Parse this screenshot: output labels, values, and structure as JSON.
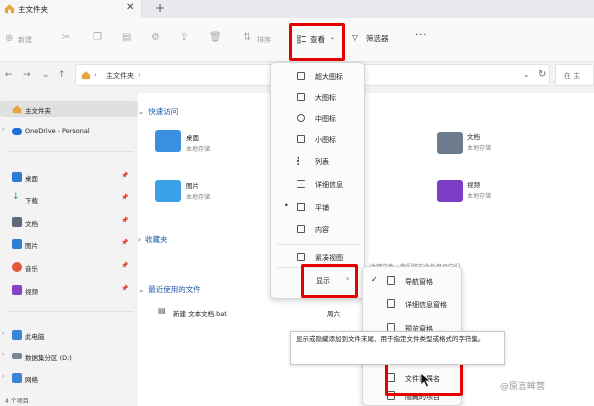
{
  "window": {
    "tab_title": "主文件夹",
    "close_glyph": "✕",
    "new_tab_glyph": "+"
  },
  "toolbar": {
    "new_label": "新建",
    "sort_label": "排序",
    "view_label": "查看",
    "filter_label": "筛选器",
    "more_glyph": "···",
    "highlight_color": "#e50000"
  },
  "address": {
    "path": "主文件夹",
    "search_label": "在 主"
  },
  "sidebar": {
    "items": [
      {
        "label": "主文件夹",
        "icon": "home-icon",
        "color": "#e8a33d",
        "selected": true
      },
      {
        "label": "OneDrive - Personal",
        "icon": "cloud-icon",
        "color": "#1e6fd9"
      },
      {
        "label": "桌面",
        "icon": "desktop-icon",
        "color": "#2c7bd6",
        "pinned": true
      },
      {
        "label": "下载",
        "icon": "download-icon",
        "color": "#2a9d5c",
        "pinned": true
      },
      {
        "label": "文档",
        "icon": "document-icon",
        "color": "#5b6b7c",
        "pinned": true
      },
      {
        "label": "图片",
        "icon": "picture-icon",
        "color": "#2f7fd6",
        "pinned": true
      },
      {
        "label": "音乐",
        "icon": "music-icon",
        "color": "#e2583e",
        "pinned": true
      },
      {
        "label": "视频",
        "icon": "video-icon",
        "color": "#8a3fc9",
        "pinned": true
      },
      {
        "label": "此电脑",
        "icon": "pc-icon",
        "color": "#3a86d4"
      },
      {
        "label": "数据集分区 (D:)",
        "icon": "drive-icon",
        "color": "#7a8694"
      },
      {
        "label": "网络",
        "icon": "network-icon",
        "color": "#3a86d4"
      }
    ],
    "status": "4 个项目"
  },
  "content": {
    "quick_access": "快速访问",
    "favorites": "收藏夹",
    "recent": "最近使用的文件",
    "favorites_hint": "收藏文件，我们将在此处显示它们",
    "tiles": [
      {
        "name": "桌面",
        "sub": "本地存储",
        "icon": "desktop-folder-icon",
        "color": "#3b8fe0"
      },
      {
        "name": "文档",
        "sub": "本地存储",
        "icon": "document-folder-icon",
        "color": "#6c7c8c"
      },
      {
        "name": "图片",
        "sub": "本地存储",
        "icon": "picture-folder-icon",
        "color": "#3aa0e8"
      },
      {
        "name": "视频",
        "sub": "本地存储",
        "icon": "video-folder-icon",
        "color": "#7d3cc4"
      }
    ],
    "recent_files": [
      {
        "name": "新建 文本文档.bat",
        "day": "周六"
      }
    ]
  },
  "view_menu": {
    "items": [
      "超大图标",
      "大图标",
      "中图标",
      "小图标",
      "列表",
      "详细信息",
      "平铺",
      "内容"
    ],
    "active": "平铺",
    "compact": "紧凑视图",
    "show": "显示",
    "arrow": "›"
  },
  "show_submenu": {
    "items": [
      {
        "label": "导航窗格",
        "checked": true
      },
      {
        "label": "详细信息窗格",
        "checked": false
      },
      {
        "label": "预览窗格",
        "checked": false
      },
      {
        "label": "文件扩展名",
        "checked": false
      },
      {
        "label": "隐藏的项目",
        "checked": false
      }
    ]
  },
  "tooltip": {
    "text": "显示或隐藏添加到文件末尾、用于指定文件类型或格式的字符集。"
  },
  "watermark": "@原言眸营"
}
